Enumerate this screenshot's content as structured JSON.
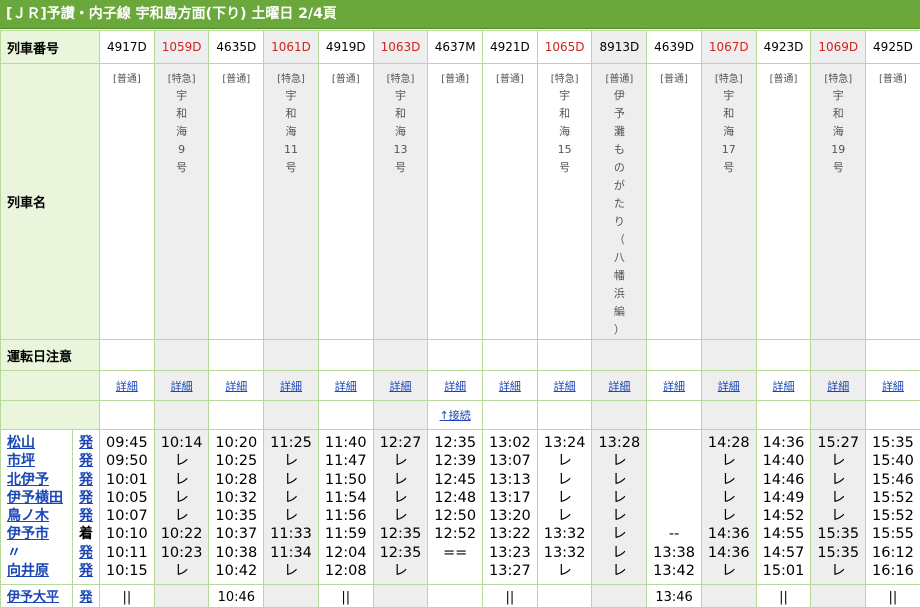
{
  "title": "[ＪＲ]予讃・内子線 宇和島方面(下り) 土曜日 2/4頁",
  "labels": {
    "train_number": "列車番号",
    "train_name": "列車名",
    "notes": "運転日注意"
  },
  "detail_label": "詳細",
  "connection_label": "↑接続",
  "trains": [
    {
      "number": "4917D",
      "red": false,
      "shade": false,
      "badge": "[普通]",
      "name": []
    },
    {
      "number": "1059D",
      "red": true,
      "shade": true,
      "badge": "[特急]",
      "name": [
        "宇",
        "和",
        "海",
        "9",
        "号"
      ]
    },
    {
      "number": "4635D",
      "red": false,
      "shade": false,
      "badge": "[普通]",
      "name": []
    },
    {
      "number": "1061D",
      "red": true,
      "shade": true,
      "badge": "[特急]",
      "name": [
        "宇",
        "和",
        "海",
        "11",
        "号"
      ]
    },
    {
      "number": "4919D",
      "red": false,
      "shade": false,
      "badge": "[普通]",
      "name": []
    },
    {
      "number": "1063D",
      "red": true,
      "shade": true,
      "badge": "[特急]",
      "name": [
        "宇",
        "和",
        "海",
        "13",
        "号"
      ]
    },
    {
      "number": "4637M",
      "red": false,
      "shade": false,
      "badge": "[普通]",
      "name": []
    },
    {
      "number": "4921D",
      "red": false,
      "shade": false,
      "badge": "[普通]",
      "name": []
    },
    {
      "number": "1065D",
      "red": true,
      "shade": false,
      "badge": "[特急]",
      "name": [
        "宇",
        "和",
        "海",
        "15",
        "号"
      ]
    },
    {
      "number": "8913D",
      "red": false,
      "shade": true,
      "badge": "[普通]",
      "name": [
        "伊",
        "予",
        "灘",
        "も",
        "の",
        "が",
        "た",
        "り",
        "（",
        "八",
        "幡",
        "浜",
        "編",
        "）"
      ]
    },
    {
      "number": "4639D",
      "red": false,
      "shade": false,
      "badge": "[普通]",
      "name": []
    },
    {
      "number": "1067D",
      "red": true,
      "shade": true,
      "badge": "[特急]",
      "name": [
        "宇",
        "和",
        "海",
        "17",
        "号"
      ]
    },
    {
      "number": "4923D",
      "red": false,
      "shade": false,
      "badge": "[普通]",
      "name": []
    },
    {
      "number": "1069D",
      "red": true,
      "shade": true,
      "badge": "[特急]",
      "name": [
        "宇",
        "和",
        "海",
        "19",
        "号"
      ]
    },
    {
      "number": "4925D",
      "red": false,
      "shade": false,
      "badge": "[普通]",
      "name": []
    }
  ],
  "stations": [
    {
      "name": "松山",
      "kind": "発",
      "link": true
    },
    {
      "name": "市坪",
      "kind": "発",
      "link": true
    },
    {
      "name": "北伊予",
      "kind": "発",
      "link": true
    },
    {
      "name": "伊予横田",
      "kind": "発",
      "link": true
    },
    {
      "name": "鳥ノ木",
      "kind": "発",
      "link": true
    },
    {
      "name": "伊予市",
      "kind": "着",
      "link": true
    },
    {
      "name": "〃",
      "kind": "発",
      "link": false
    },
    {
      "name": "向井原",
      "kind": "発",
      "link": true
    }
  ],
  "times": [
    [
      "09:45",
      "09:50",
      "10:01",
      "10:05",
      "10:07",
      "10:10",
      "10:11",
      "10:15"
    ],
    [
      "10:14",
      "レ",
      "レ",
      "レ",
      "レ",
      "10:22",
      "10:23",
      "レ"
    ],
    [
      "10:20",
      "10:25",
      "10:28",
      "10:32",
      "10:35",
      "10:37",
      "10:38",
      "10:42"
    ],
    [
      "11:25",
      "レ",
      "レ",
      "レ",
      "レ",
      "11:33",
      "11:34",
      "レ"
    ],
    [
      "11:40",
      "11:47",
      "11:50",
      "11:54",
      "11:56",
      "11:59",
      "12:04",
      "12:08"
    ],
    [
      "12:27",
      "レ",
      "レ",
      "レ",
      "レ",
      "12:35",
      "12:35",
      "レ"
    ],
    [
      "12:35",
      "12:39",
      "12:45",
      "12:48",
      "12:50",
      "12:52",
      "==",
      ""
    ],
    [
      "13:02",
      "13:07",
      "13:13",
      "13:17",
      "13:20",
      "13:22",
      "13:23",
      "13:27"
    ],
    [
      "13:24",
      "レ",
      "レ",
      "レ",
      "レ",
      "13:32",
      "13:32",
      "レ"
    ],
    [
      "13:28",
      "レ",
      "レ",
      "レ",
      "レ",
      "レ",
      "レ",
      "レ"
    ],
    [
      "",
      "",
      "",
      "",
      "",
      "--",
      "13:38",
      "13:42"
    ],
    [
      "14:28",
      "レ",
      "レ",
      "レ",
      "レ",
      "14:36",
      "14:36",
      "レ"
    ],
    [
      "14:36",
      "14:40",
      "14:46",
      "14:49",
      "14:52",
      "14:55",
      "14:57",
      "15:01"
    ],
    [
      "15:27",
      "レ",
      "レ",
      "レ",
      "レ",
      "15:35",
      "15:35",
      "レ"
    ],
    [
      "15:35",
      "15:40",
      "15:46",
      "15:52",
      "15:52",
      "15:55",
      "16:12",
      "16:16"
    ]
  ],
  "partial_row": {
    "station": "伊予大平",
    "kind": "発",
    "times": [
      "||",
      "",
      "10:46",
      "",
      "||",
      "",
      "",
      "||",
      "",
      "",
      "13:46",
      "",
      "||",
      "",
      "||"
    ]
  }
}
